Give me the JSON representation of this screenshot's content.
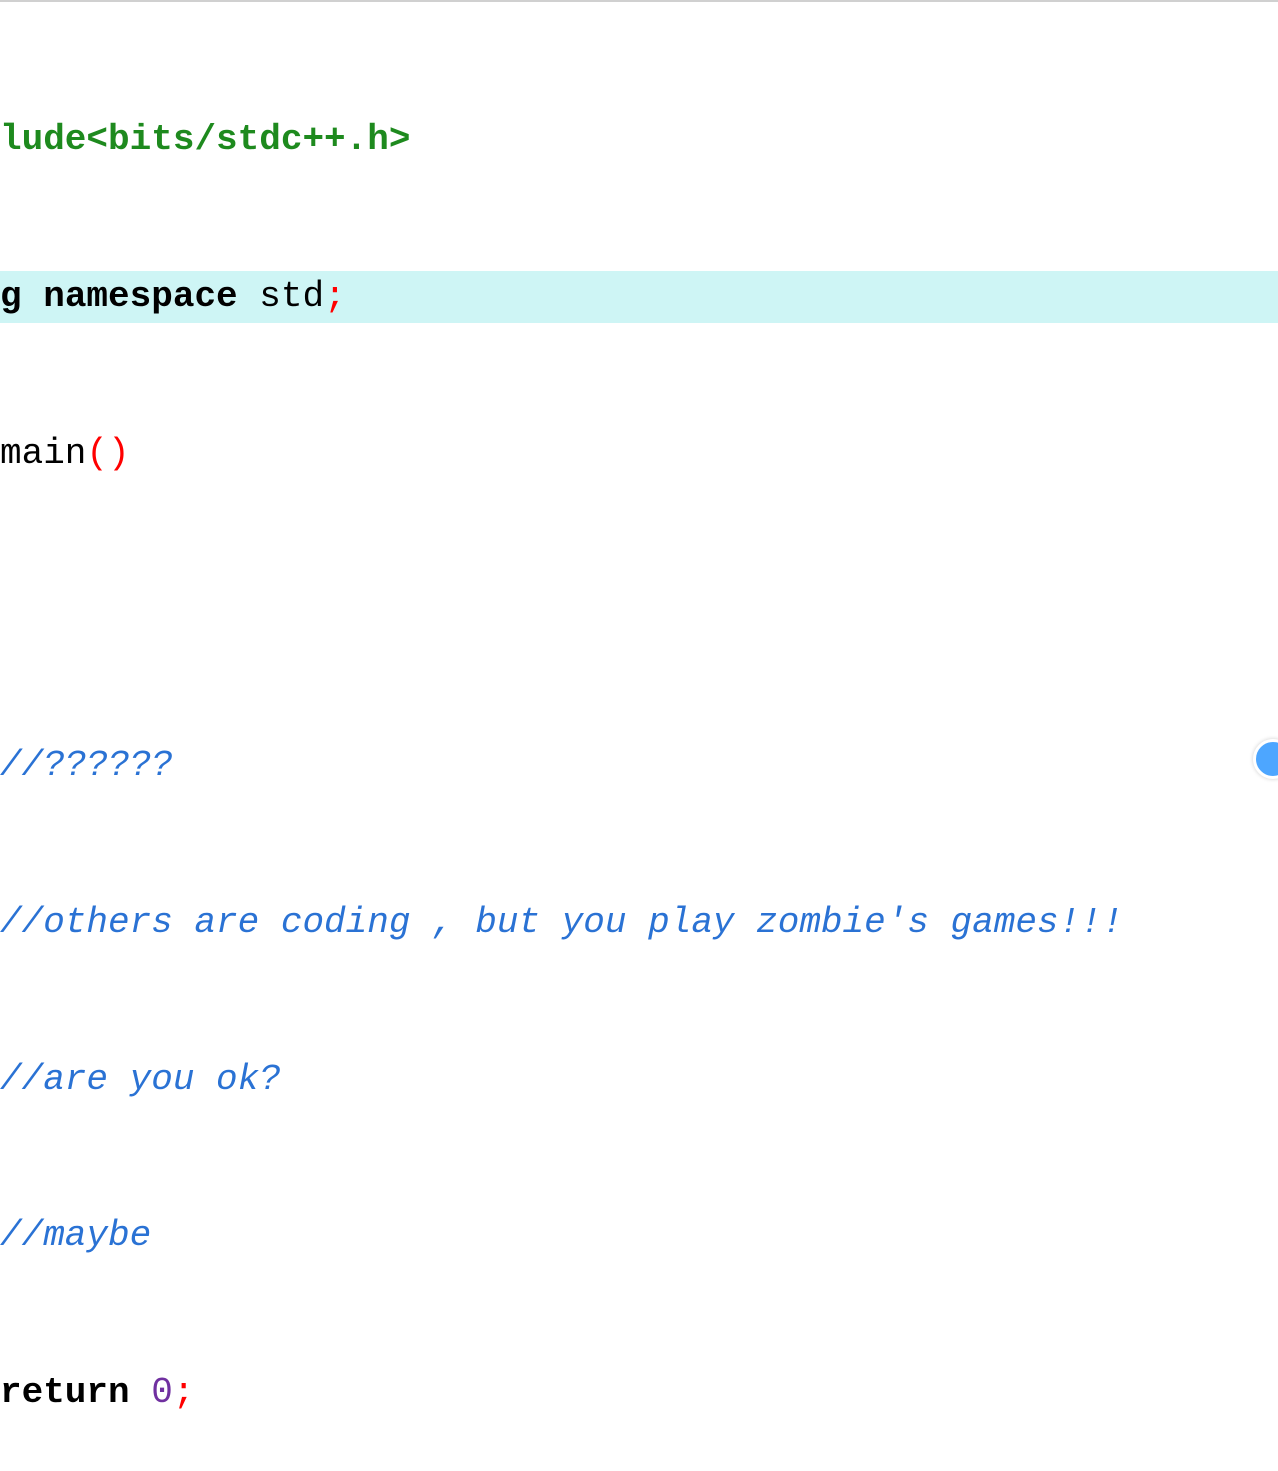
{
  "code": {
    "line1": {
      "part1": "lude",
      "part2": "<bits/stdc++.h>"
    },
    "line2": {
      "part1": "g ",
      "part2": "namespace",
      "part3": " std",
      "part4": ";"
    },
    "line3": {
      "part1": "main",
      "part2": "()"
    },
    "line4": "",
    "line5": "//??????",
    "line6": "//others are coding , but you play zombie's games!!!",
    "line7": "//are you ok?",
    "line8": "//maybe",
    "line9": {
      "part1": "return",
      "part2": " ",
      "part3": "0",
      "part4": ";"
    }
  }
}
